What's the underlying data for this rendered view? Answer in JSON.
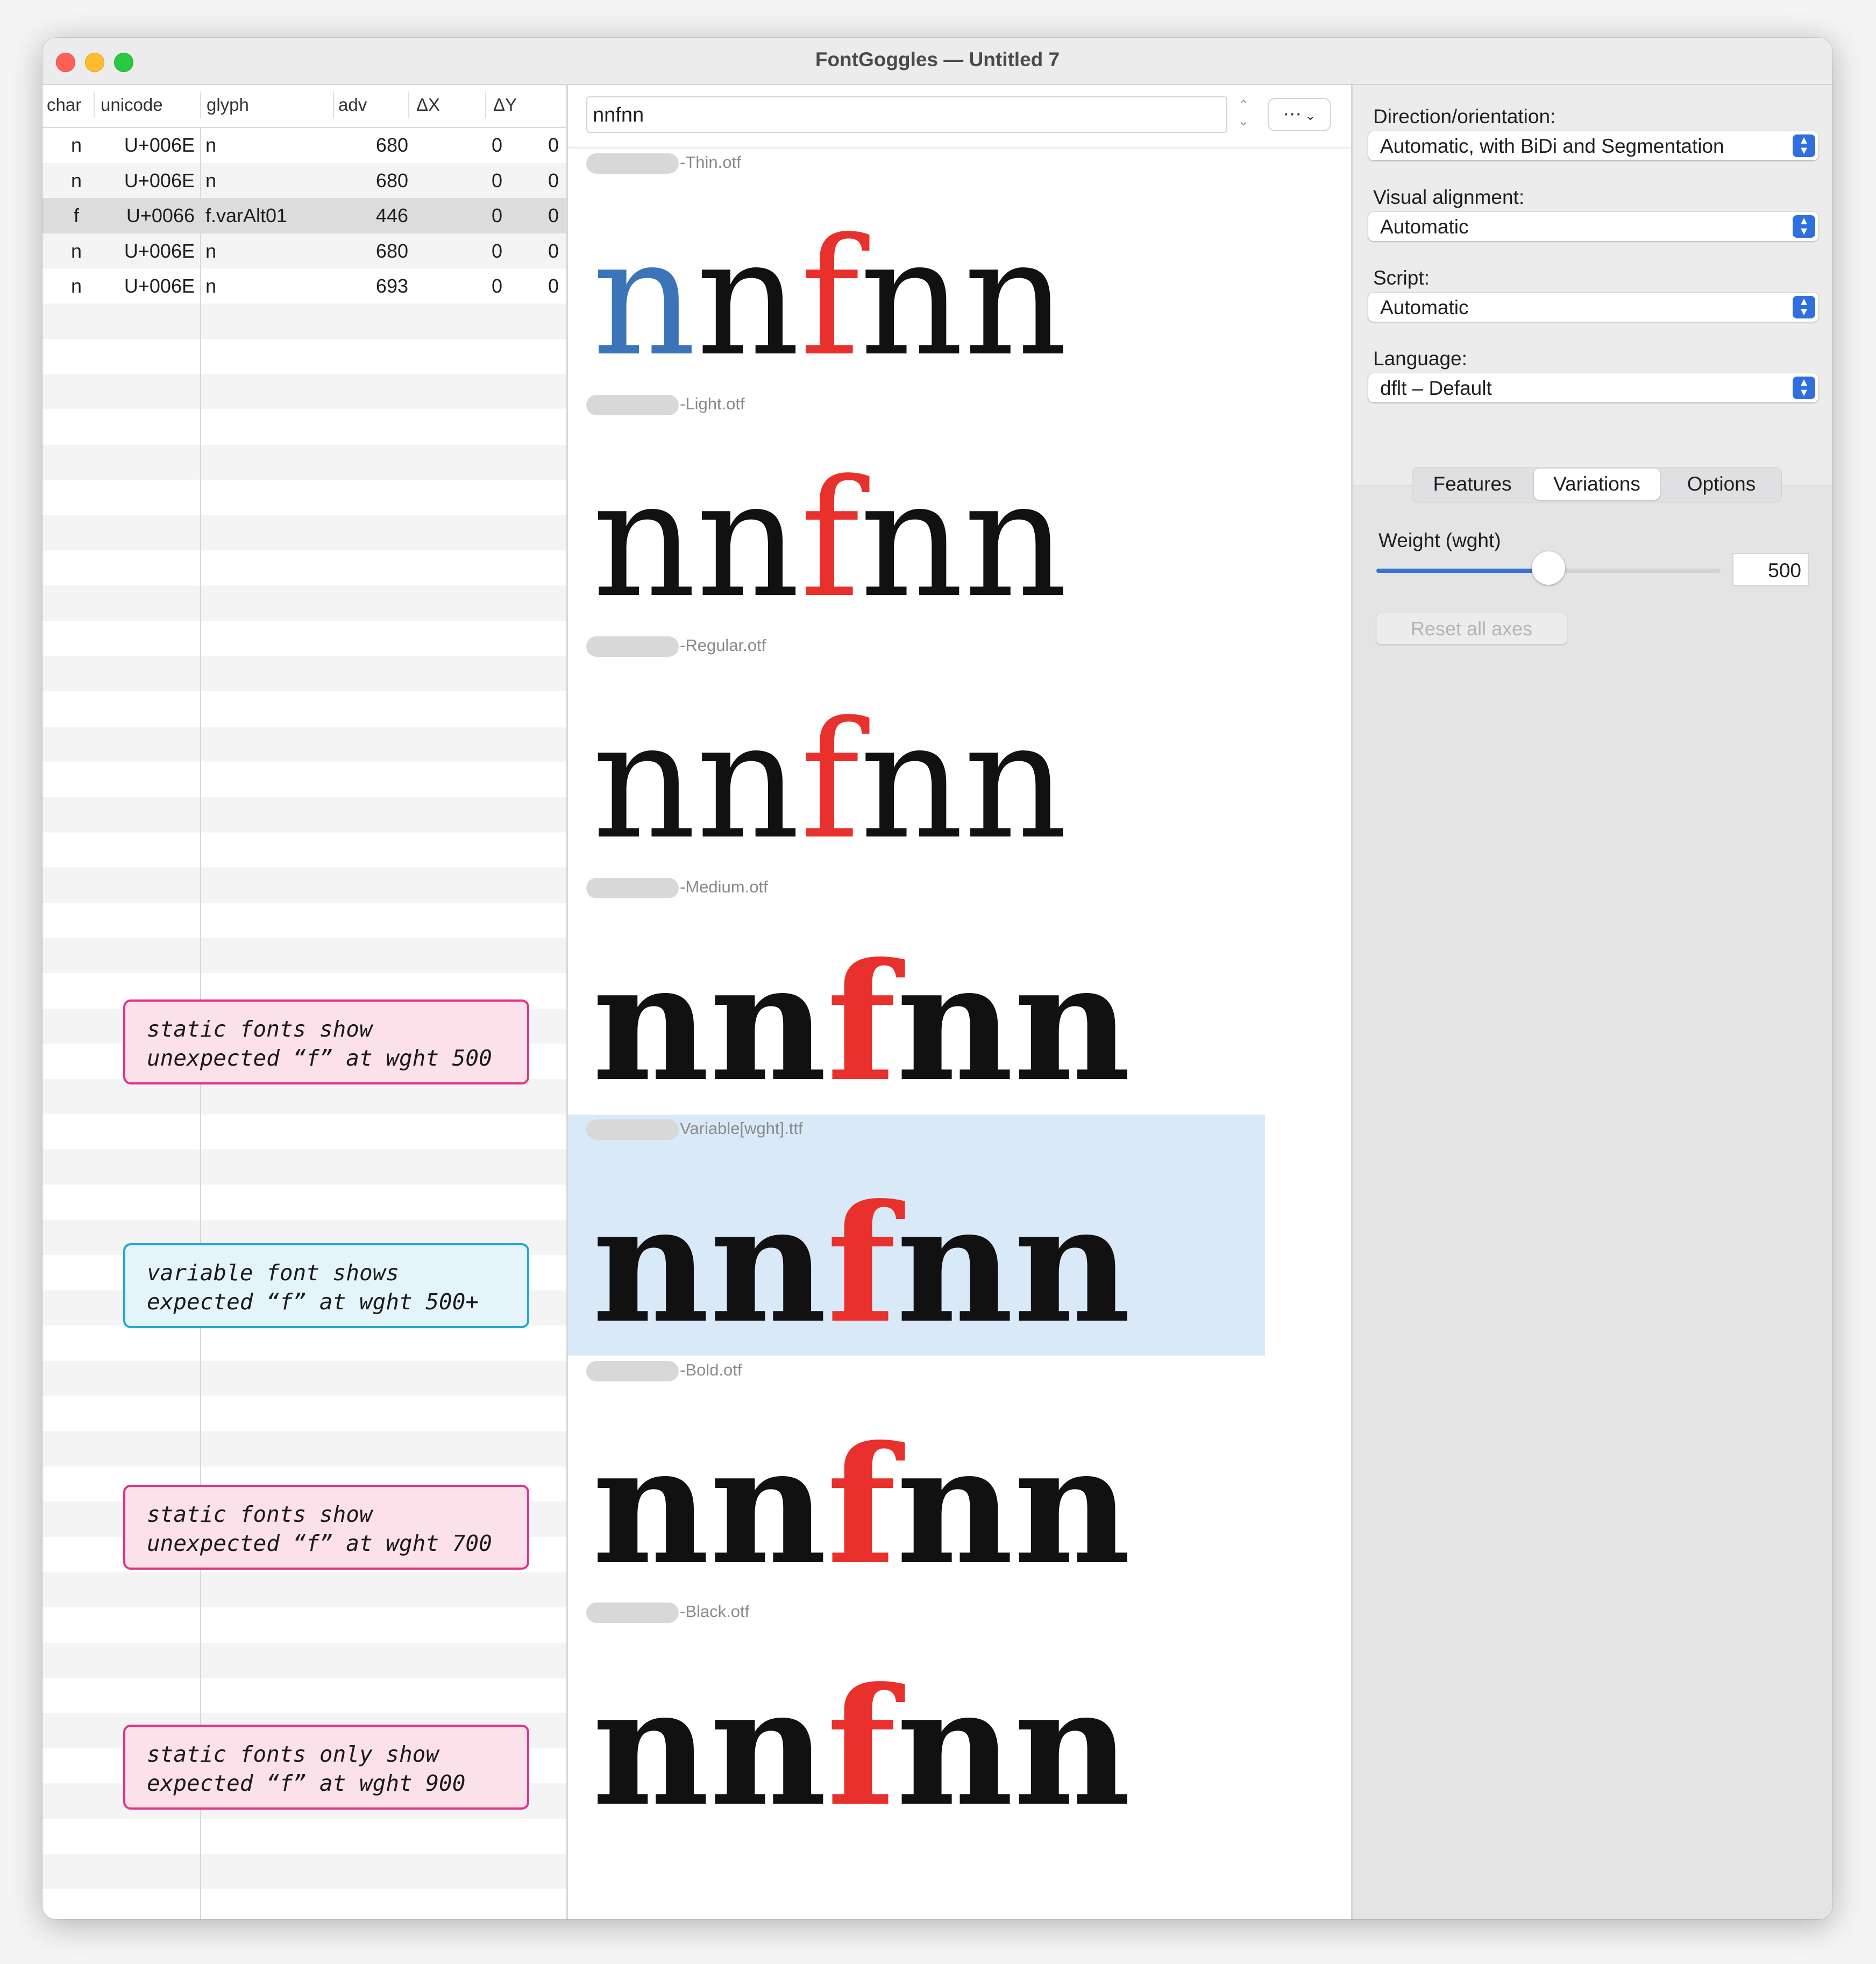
{
  "window": {
    "title": "FontGoggles — Untitled 7"
  },
  "glyph_table": {
    "columns": [
      "char",
      "unicode",
      "glyph",
      "adv",
      "ΔX",
      "ΔY"
    ],
    "rows": [
      {
        "char": "n",
        "unicode": "U+006E",
        "glyph": "n",
        "adv": "680",
        "dx": "0",
        "dy": "0",
        "selected": false
      },
      {
        "char": "n",
        "unicode": "U+006E",
        "glyph": "n",
        "adv": "680",
        "dx": "0",
        "dy": "0",
        "selected": false
      },
      {
        "char": "f",
        "unicode": "U+0066",
        "glyph": "f.varAlt01",
        "adv": "446",
        "dx": "0",
        "dy": "0",
        "selected": true
      },
      {
        "char": "n",
        "unicode": "U+006E",
        "glyph": "n",
        "adv": "680",
        "dx": "0",
        "dy": "0",
        "selected": false
      },
      {
        "char": "n",
        "unicode": "U+006E",
        "glyph": "n",
        "adv": "693",
        "dx": "0",
        "dy": "0",
        "selected": false
      }
    ]
  },
  "annotations": [
    {
      "line1": "static fonts show",
      "line2": "unexpected “f” at wght 500",
      "style": "pink"
    },
    {
      "line1": "variable font shows",
      "line2": "expected “f” at wght 500+",
      "style": "cyan"
    },
    {
      "line1": "static fonts show",
      "line2": "unexpected “f” at wght 700",
      "style": "pink"
    },
    {
      "line1": "static fonts only show",
      "line2": "expected “f” at wght 900",
      "style": "pink"
    }
  ],
  "preview": {
    "input_text": "nnfnn",
    "options_icon": "ellipsis-circle-icon",
    "fonts": [
      {
        "name": "-Thin.otf",
        "weight": 100,
        "selected": false,
        "first_glyph_highlighted": true
      },
      {
        "name": "-Light.otf",
        "weight": 300,
        "selected": false,
        "first_glyph_highlighted": false
      },
      {
        "name": "-Regular.otf",
        "weight": 400,
        "selected": false,
        "first_glyph_highlighted": false
      },
      {
        "name": "-Medium.otf",
        "weight": 700,
        "selected": false,
        "first_glyph_highlighted": false
      },
      {
        "name": "Variable[wght].ttf",
        "weight": 700,
        "selected": true,
        "first_glyph_highlighted": false
      },
      {
        "name": "-Bold.otf",
        "weight": 800,
        "selected": false,
        "first_glyph_highlighted": false
      },
      {
        "name": "-Black.otf",
        "weight": 900,
        "selected": false,
        "first_glyph_highlighted": false
      }
    ],
    "colors": {
      "highlight_glyph": "#e8302c",
      "selected_glyph": "#3b74b9",
      "selected_row": "#dae9f8"
    }
  },
  "inspector": {
    "direction": {
      "label": "Direction/orientation:",
      "value": "Automatic, with BiDi and Segmentation"
    },
    "alignment": {
      "label": "Visual alignment:",
      "value": "Automatic"
    },
    "script": {
      "label": "Script:",
      "value": "Automatic"
    },
    "language": {
      "label": "Language:",
      "value": "dflt – Default"
    },
    "tabs": [
      "Features",
      "Variations",
      "Options"
    ],
    "active_tab": "Variations",
    "axis": {
      "label": "Weight (wght)",
      "value": "500",
      "min": 100,
      "max": 900,
      "current": 500
    },
    "reset_label": "Reset all axes"
  }
}
